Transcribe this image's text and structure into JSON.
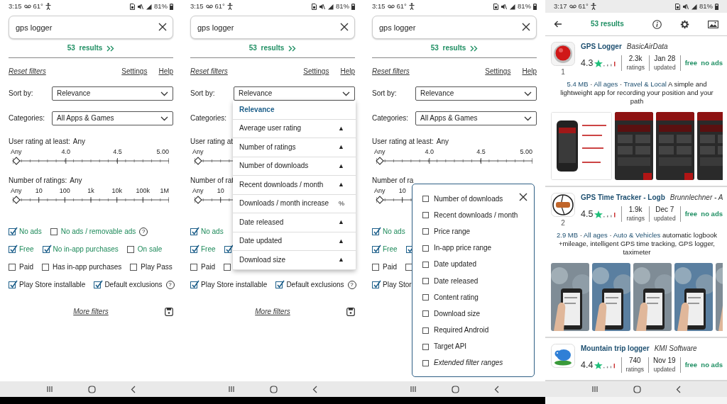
{
  "screens": [
    {
      "kind": "filters",
      "status_bar": {
        "time": "3:15",
        "temperature": "61°",
        "battery": "81%"
      },
      "search": {
        "value": "gps logger"
      },
      "results_link": "53 results",
      "links": {
        "reset": "Reset filters",
        "settings": "Settings",
        "help": "Help"
      },
      "sort": {
        "label": "Sort by:",
        "value": "Relevance"
      },
      "categories": {
        "label": "Categories:",
        "value": "All Apps & Games"
      },
      "rating_filter": {
        "label": "User rating at least:",
        "value": "Any",
        "ticks": [
          "Any",
          "4.0",
          "4.5",
          "5.00"
        ],
        "level": 0
      },
      "count_filter": {
        "label": "Number of ratings:",
        "value": "Any",
        "ticks": [
          "Any",
          "10",
          "100",
          "1k",
          "10k",
          "100k",
          "1M"
        ],
        "level": 0
      },
      "checkbox_rows": [
        {
          "items": [
            {
              "label": "No ads",
              "checked": true,
              "kind": "accent"
            },
            {
              "label": "No ads / removable ads",
              "checked": false,
              "kind": "accent",
              "help": "?"
            }
          ]
        },
        {
          "items": [
            {
              "label": "Free",
              "checked": true,
              "kind": "accent"
            },
            {
              "label": "No in-app purchases",
              "checked": true,
              "kind": "accent"
            },
            {
              "label": "On sale",
              "checked": false,
              "kind": "accent"
            }
          ]
        },
        {
          "items": [
            {
              "label": "Paid",
              "checked": false,
              "kind": "plain"
            },
            {
              "label": "Has in-app purchases",
              "checked": false,
              "kind": "plain"
            },
            {
              "label": "Play Pass",
              "checked": false,
              "kind": "plain"
            }
          ]
        },
        {
          "items": [
            {
              "label": "Play Store installable",
              "checked": true,
              "kind": "plain"
            },
            {
              "label": "Default exclusions",
              "checked": true,
              "kind": "plain",
              "help": "?"
            }
          ]
        }
      ],
      "more_filters": "More filters"
    },
    {
      "kind": "filters",
      "status_bar": {
        "time": "3:15",
        "temperature": "61°",
        "battery": "81%"
      },
      "search": {
        "value": "gps logger"
      },
      "results_link": "53 results",
      "links": {
        "reset": "Reset filters",
        "settings": "Settings",
        "help": "Help"
      },
      "sort": {
        "label": "Sort by:",
        "value": "Relevance"
      },
      "categories": {
        "label": "Categories:"
      },
      "rating_filter": {
        "label": "User rating at",
        "ticks": [
          "Any"
        ],
        "level": 0
      },
      "count_filter": {
        "label": "Number of rat",
        "ticks": [
          "Any",
          "10"
        ],
        "level": 0
      },
      "checkbox_rows": [
        {
          "items": [
            {
              "label": "No ads",
              "checked": true,
              "kind": "accent"
            }
          ]
        },
        {
          "items": [
            {
              "label": "Free",
              "checked": true,
              "kind": "accent"
            },
            {
              "checked": true
            }
          ]
        },
        {
          "items": [
            {
              "label": "Paid",
              "checked": false,
              "kind": "plain"
            },
            {
              "checked": false
            }
          ]
        },
        {
          "items": [
            {
              "label": "Play Store installable",
              "checked": true,
              "kind": "plain"
            },
            {
              "label": "Default exclusions",
              "checked": true,
              "kind": "plain",
              "help": "?"
            }
          ]
        }
      ],
      "more_filters": "More filters",
      "dropdown": {
        "options": [
          {
            "label": "Relevance",
            "selected": true
          },
          {
            "label": "Average user rating",
            "suffix": "▲",
            "selected": false
          },
          {
            "label": "Number of ratings",
            "suffix": "▲",
            "selected": false
          },
          {
            "label": "Number of downloads",
            "suffix": "▲",
            "selected": false
          },
          {
            "label": "Recent downloads / month",
            "suffix": "▲",
            "selected": false
          },
          {
            "label": "Downloads / month increase",
            "suffix": "%",
            "selected": false
          },
          {
            "label": "Date released",
            "suffix": "▲",
            "selected": false
          },
          {
            "label": "Date updated",
            "suffix": "▲",
            "selected": false
          },
          {
            "label": "Download size",
            "suffix": "▲",
            "selected": false
          }
        ]
      }
    },
    {
      "kind": "filters",
      "status_bar": {
        "time": "3:15",
        "temperature": "61°",
        "battery": "81%"
      },
      "search": {
        "value": "gps logger"
      },
      "results_link": "53 results",
      "links": {
        "reset": "Reset filters",
        "settings": "Settings",
        "help": "Help"
      },
      "sort": {
        "label": "Sort by:",
        "value": "Relevance"
      },
      "categories": {
        "label": "Categories:",
        "value": "All Apps & Games"
      },
      "rating_filter": {
        "label": "User rating at least:",
        "value": "Any",
        "ticks": [
          "Any",
          "4.0",
          "4.5",
          "5.00"
        ],
        "level": 0
      },
      "count_filter": {
        "label": "Number of ra",
        "ticks": [
          "Any",
          "10"
        ],
        "level": 0
      },
      "checkbox_rows": [
        {
          "items": [
            {
              "label": "No ads",
              "checked": true,
              "kind": "accent"
            }
          ]
        },
        {
          "items": [
            {
              "label": "Free",
              "checked": true,
              "kind": "accent"
            },
            {
              "checked": true
            }
          ]
        },
        {
          "items": [
            {
              "label": "Paid",
              "checked": false,
              "kind": "plain"
            },
            {
              "checked": false
            }
          ]
        },
        {
          "items": [
            {
              "label": "Play Stor",
              "checked": true,
              "kind": "plain"
            }
          ]
        }
      ],
      "popup": {
        "options": [
          {
            "label": "Number of downloads",
            "checked": false,
            "kind": "filter"
          },
          {
            "label": "Recent downloads / month",
            "checked": false,
            "kind": "filter"
          },
          {
            "label": "Price range",
            "checked": false,
            "kind": "filter"
          },
          {
            "label": "In-app price range",
            "checked": false,
            "kind": "filter"
          },
          {
            "label": "Date updated",
            "checked": false,
            "kind": "filter"
          },
          {
            "label": "Date released",
            "checked": false,
            "kind": "filter"
          },
          {
            "label": "Content rating",
            "checked": false,
            "kind": "filter"
          },
          {
            "label": "Download size",
            "checked": false,
            "kind": "filter"
          },
          {
            "label": "Required Android",
            "checked": false,
            "kind": "filter"
          },
          {
            "label": "Target API",
            "checked": false,
            "kind": "filter"
          },
          {
            "label": "Extended filter ranges",
            "checked": false,
            "kind": "extended"
          }
        ]
      }
    },
    {
      "kind": "results",
      "status_bar": {
        "time": "3:17",
        "temperature": "61°",
        "battery": "81%"
      },
      "toolbar": {
        "title": "53 results"
      },
      "apps": [
        {
          "rank": "1",
          "title": "GPS Logger",
          "developer": "BasicAirData",
          "rating": "4.3",
          "ratings_count": "2.3k",
          "ratings_label": "ratings",
          "date": "Jan 28",
          "date_label": "updated",
          "price": "free  no ads",
          "tags": [
            {
              "text": "5.4 MB",
              "kind": "link"
            },
            {
              "text": "·",
              "kind": "separator"
            },
            {
              "text": "All ages",
              "kind": "link"
            },
            {
              "text": "·",
              "kind": "separator"
            },
            {
              "text": "Travel & Local",
              "kind": "link"
            }
          ],
          "description": "A simple and lightweight app for recording your position and your path"
        },
        {
          "rank": "2",
          "title": "GPS Time Tracker - Logb",
          "developer": "Brunnlechner - A",
          "rating": "4.5",
          "ratings_count": "1.9k",
          "ratings_label": "ratings",
          "date": "Dec 7",
          "date_label": "updated",
          "price": "free  no ads",
          "tags": [
            {
              "text": "2.9 MB",
              "kind": "link"
            },
            {
              "text": "·",
              "kind": "separator"
            },
            {
              "text": "All ages",
              "kind": "link"
            },
            {
              "text": "·",
              "kind": "separator"
            },
            {
              "text": "Auto & Vehicles",
              "kind": "link"
            }
          ],
          "description": "automatic logbook +mileage, intelligent GPS time tracking, GPS logger, taximeter"
        },
        {
          "title": "Mountain trip logger",
          "developer": "KMI Software",
          "rating": "4.4",
          "ratings_count": "740",
          "ratings_label": "ratings",
          "date": "Nov 19",
          "date_label": "updated",
          "price": "free  no ads"
        }
      ]
    }
  ]
}
